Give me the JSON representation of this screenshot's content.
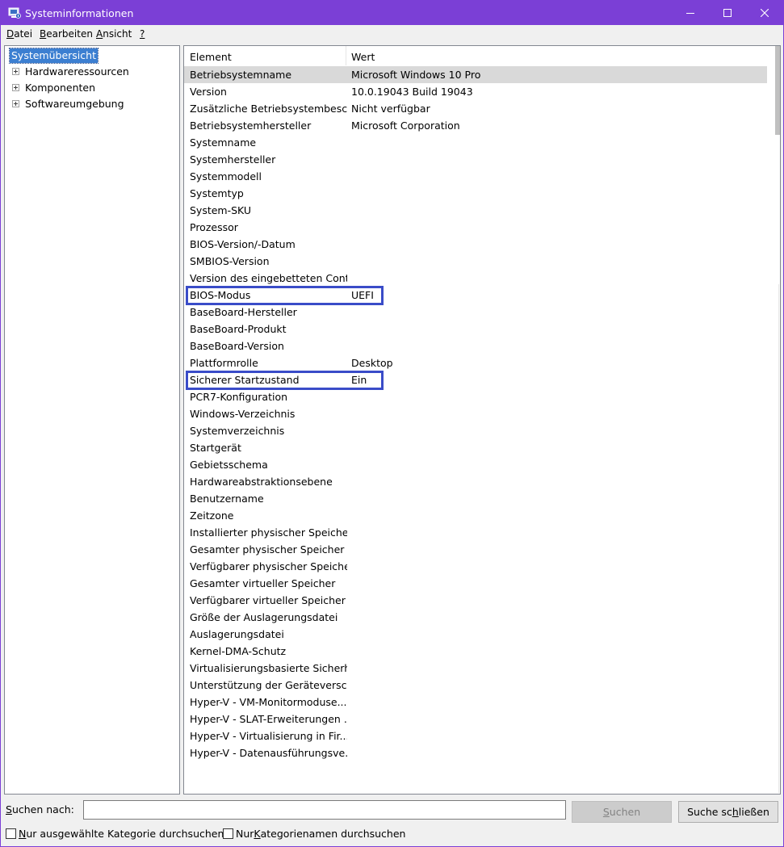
{
  "window": {
    "title": "Systeminformationen",
    "title_bar_color": "#7b3fd6",
    "icons": [
      "app-icon",
      "minimize-icon",
      "maximize-icon",
      "close-icon"
    ]
  },
  "menu": {
    "datei": {
      "accel": "D",
      "rest": "atei"
    },
    "bearbeiten": {
      "accel": "B",
      "rest": "earbeiten"
    },
    "ansicht": {
      "accel": "A",
      "rest": "nsicht"
    },
    "help": {
      "accel": "?",
      "rest": ""
    }
  },
  "tree": {
    "root": "Systemübersicht",
    "nodes": [
      {
        "label": "Hardwareressourcen"
      },
      {
        "label": "Komponenten"
      },
      {
        "label": "Softwareumgebung"
      }
    ]
  },
  "list": {
    "columns": {
      "element": "Element",
      "value": "Wert"
    },
    "rows": [
      {
        "element": "Betriebsystemname",
        "value": "Microsoft Windows 10 Pro"
      },
      {
        "element": "Version",
        "value": "10.0.19043 Build 19043"
      },
      {
        "element": "Zusätzliche Betriebsystembesch...",
        "value": "Nicht verfügbar"
      },
      {
        "element": "Betriebsystemhersteller",
        "value": "Microsoft Corporation"
      },
      {
        "element": "Systemname",
        "value": ""
      },
      {
        "element": "Systemhersteller",
        "value": ""
      },
      {
        "element": "Systemmodell",
        "value": ""
      },
      {
        "element": "Systemtyp",
        "value": ""
      },
      {
        "element": "System-SKU",
        "value": ""
      },
      {
        "element": "Prozessor",
        "value": ""
      },
      {
        "element": "BIOS-Version/-Datum",
        "value": ""
      },
      {
        "element": "SMBIOS-Version",
        "value": ""
      },
      {
        "element": "Version des eingebetteten Cont...",
        "value": ""
      },
      {
        "element": "BIOS-Modus",
        "value": "UEFI"
      },
      {
        "element": "BaseBoard-Hersteller",
        "value": ""
      },
      {
        "element": "BaseBoard-Produkt",
        "value": ""
      },
      {
        "element": "BaseBoard-Version",
        "value": ""
      },
      {
        "element": "Plattformrolle",
        "value": "Desktop"
      },
      {
        "element": "Sicherer Startzustand",
        "value": "Ein"
      },
      {
        "element": "PCR7-Konfiguration",
        "value": ""
      },
      {
        "element": "Windows-Verzeichnis",
        "value": ""
      },
      {
        "element": "Systemverzeichnis",
        "value": ""
      },
      {
        "element": "Startgerät",
        "value": ""
      },
      {
        "element": "Gebietsschema",
        "value": ""
      },
      {
        "element": "Hardwareabstraktionsebene",
        "value": ""
      },
      {
        "element": "Benutzername",
        "value": ""
      },
      {
        "element": "Zeitzone",
        "value": ""
      },
      {
        "element": "Installierter physischer Speicher...",
        "value": ""
      },
      {
        "element": "Gesamter physischer Speicher",
        "value": ""
      },
      {
        "element": "Verfügbarer physischer Speicher",
        "value": ""
      },
      {
        "element": "Gesamter virtueller Speicher",
        "value": ""
      },
      {
        "element": "Verfügbarer virtueller Speicher",
        "value": ""
      },
      {
        "element": "Größe der Auslagerungsdatei",
        "value": ""
      },
      {
        "element": "Auslagerungsdatei",
        "value": ""
      },
      {
        "element": "Kernel-DMA-Schutz",
        "value": ""
      },
      {
        "element": "Virtualisierungsbasierte Sicherh...",
        "value": ""
      },
      {
        "element": "Unterstützung der Geräteversc...",
        "value": ""
      },
      {
        "element": "Hyper-V - VM-Monitormoduse...",
        "value": ""
      },
      {
        "element": "Hyper-V - SLAT-Erweiterungen ...",
        "value": ""
      },
      {
        "element": "Hyper-V - Virtualisierung in Fir...",
        "value": ""
      },
      {
        "element": "Hyper-V - Datenausführungsve...",
        "value": ""
      }
    ],
    "highlighted_rows": [
      "BIOS-Modus",
      "Sicherer Startzustand"
    ],
    "highlight_color": "#3a4cc8"
  },
  "search": {
    "label_accel": "S",
    "label_rest": "uchen nach:",
    "value": "",
    "search_button_accel": "S",
    "search_button_rest": "uchen",
    "close_button_pre": "Suche sc",
    "close_button_accel": "h",
    "close_button_post": "ließen",
    "checkbox_selected_pre": "",
    "checkbox_selected_accel": "N",
    "checkbox_selected_rest": "ur ausgewählte Kategorie durchsuchen",
    "checkbox_selected_checked": false,
    "checkbox_names_pre": "Nur ",
    "checkbox_names_accel": "K",
    "checkbox_names_rest": "ategorienamen durchsuchen",
    "checkbox_names_checked": false
  }
}
